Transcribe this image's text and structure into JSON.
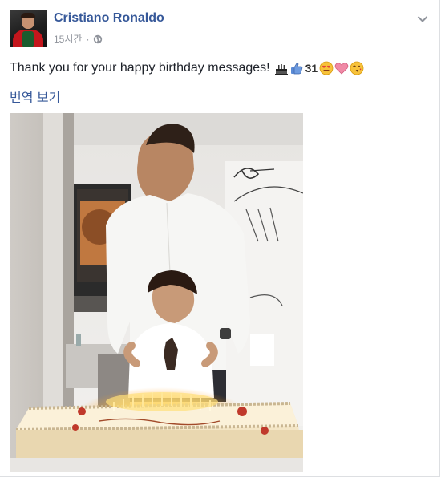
{
  "post": {
    "author": "Cristiano Ronaldo",
    "time": "15시간",
    "separator": "·",
    "status_text": "Thank you for your happy birthday messages! ",
    "cake_number": "31",
    "translate_link": "번역 보기",
    "icons": {
      "avatar": "avatar-photo",
      "privacy": "globe-icon",
      "options": "chevron-down-icon",
      "emojis": [
        "cake-emoji",
        "thumbs-up-emoji",
        "number-31",
        "heart-eyes-emoji",
        "heart-emoji",
        "wink-kiss-emoji"
      ]
    },
    "photo": {
      "description_icon": "birthday-photo"
    },
    "colors": {
      "link": "#365899",
      "meta": "#90949c",
      "text": "#1d2129"
    }
  }
}
